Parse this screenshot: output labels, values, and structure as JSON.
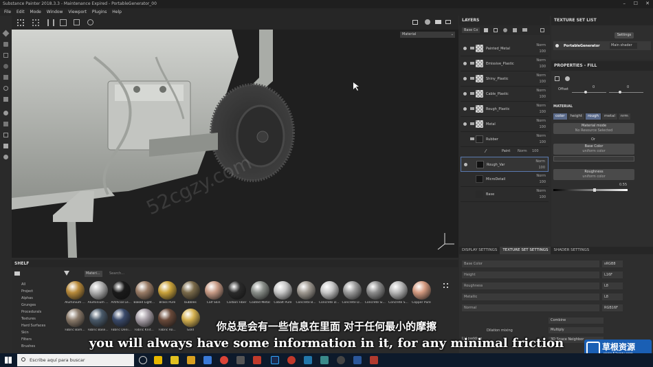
{
  "app": {
    "title": "Substance Painter 2018.3.3 - Maintenance Expired - PortableGenerator_00"
  },
  "menu": [
    "File",
    "Edit",
    "Mode",
    "Window",
    "Viewport",
    "Plugins",
    "Help"
  ],
  "viewport": {
    "display_mode": "Material"
  },
  "layers": {
    "title": "LAYERS",
    "channel": "Base Co",
    "items": [
      {
        "name": "Painted_Metal",
        "blend": "Norm",
        "opacity": "100"
      },
      {
        "name": "Emissive_Plastic",
        "blend": "Norm",
        "opacity": "100"
      },
      {
        "name": "Shiny_Plastic",
        "blend": "Norm",
        "opacity": "100"
      },
      {
        "name": "Cable_Plastic",
        "blend": "Norm",
        "opacity": "100"
      },
      {
        "name": "Rough_Plastic",
        "blend": "Norm",
        "opacity": "100"
      },
      {
        "name": "Metal",
        "blend": "Norm",
        "opacity": "100"
      },
      {
        "name": "Rubber",
        "blend": "Norm",
        "opacity": "100"
      },
      {
        "name": "Rough_Var",
        "blend": "Norm",
        "opacity": "100"
      },
      {
        "name": "MicroDetail",
        "blend": "Norm",
        "opacity": "100"
      },
      {
        "name": "Base",
        "blend": "Norm",
        "opacity": "100"
      }
    ],
    "paint_sub": {
      "name": "Paint",
      "blend": "Norm",
      "opacity": "100"
    }
  },
  "texture_set_list": {
    "title": "TEXTURE SET LIST",
    "settings_label": "Settings",
    "set_name": "PortableGenerator",
    "shader": "Main shader"
  },
  "properties": {
    "title": "PROPERTIES - FILL",
    "offset_label": "Offset",
    "offset_x": "0",
    "offset_y": "0",
    "material_label": "MATERIAL",
    "channels": [
      "color",
      "height",
      "rough",
      "metal",
      "nrm"
    ],
    "material_mode_label": "Material mode",
    "material_mode_value": "No Resource Selected",
    "or_label": "Or",
    "base_color_label": "Base Color",
    "base_color_value": "uniform color",
    "roughness_label": "Roughness",
    "roughness_value": "uniform color",
    "roughness_num": "0.55"
  },
  "settings_tabs": [
    "DISPLAY SETTINGS",
    "TEXTURE SET SETTINGS",
    "SHADER SETTINGS"
  ],
  "texture_settings": {
    "rows": [
      {
        "label": "Base Color",
        "format": "sRGB8"
      },
      {
        "label": "Height",
        "format": "L16F"
      },
      {
        "label": "Roughness",
        "format": "L8"
      },
      {
        "label": "Metallic",
        "format": "L8"
      },
      {
        "label": "Normal",
        "format": "RGB16F"
      }
    ],
    "combine": "Combine",
    "multiply": "Multiply",
    "uv_padding": "UV padding",
    "dilation": "Dilation mixing",
    "space": "3D Space Neighbor"
  },
  "shelf": {
    "title": "SHELF",
    "filter_tag": "Materi...",
    "search_placeholder": "Search...",
    "categories": [
      "All",
      "Project",
      "Alphas",
      "Grunges",
      "Procedurals",
      "Textures",
      "Hard Surfaces",
      "Skin",
      "Filters",
      "Brushes"
    ],
    "materials": [
      {
        "name": "Aluminium ...",
        "color": "#b88a3a"
      },
      {
        "name": "Aluminium ...",
        "color": "#b0b0b0"
      },
      {
        "name": "Artificial Le...",
        "color": "#1a1a1a"
      },
      {
        "name": "Baked Light...",
        "color": "#9a7c66"
      },
      {
        "name": "Brass Pure",
        "color": "#c9a23a"
      },
      {
        "name": "bubbles",
        "color": "#7a6a4a"
      },
      {
        "name": "Calf Skin",
        "color": "#c89b86"
      },
      {
        "name": "Carbon Fiber",
        "color": "#2a2a2a"
      },
      {
        "name": "Coated Metal",
        "color": "#8a8f8a"
      },
      {
        "name": "Cobalt Pure",
        "color": "#c7c7c7"
      },
      {
        "name": "Concrete B...",
        "color": "#a09a92"
      },
      {
        "name": "Concrete D...",
        "color": "#c8c8c8"
      },
      {
        "name": "Concrete D...",
        "color": "#9b9b9b"
      },
      {
        "name": "Concrete Si...",
        "color": "#8c8c8c"
      },
      {
        "name": "Concrete S...",
        "color": "#b8b8b8"
      },
      {
        "name": "Copper Pure",
        "color": "#d49a80"
      }
    ],
    "materials_row2": [
      {
        "name": "Fabric Bam...",
        "color": "#8a7a6a"
      },
      {
        "name": "Fabric Base...",
        "color": "#4a5a6a"
      },
      {
        "name": "Fabric Deni...",
        "color": "#3a4a6a"
      },
      {
        "name": "Fabric Knit...",
        "color": "#a8a0a8"
      },
      {
        "name": "Fabric Ro...",
        "color": "#6a4a3a"
      },
      {
        "name": "Gold",
        "color": "#d4b050"
      }
    ]
  },
  "subtitles": {
    "cn": "你总是会有一些信息在里面 对于任何最小的摩擦",
    "en": "you will always have some information in it, for any minimal friction"
  },
  "watermark": "52cgzy.com",
  "taskbar": {
    "search_placeholder": "Escribe aquí para buscar"
  },
  "logo": {
    "text": "草根资源",
    "sub": "www.52cgzy.com"
  }
}
